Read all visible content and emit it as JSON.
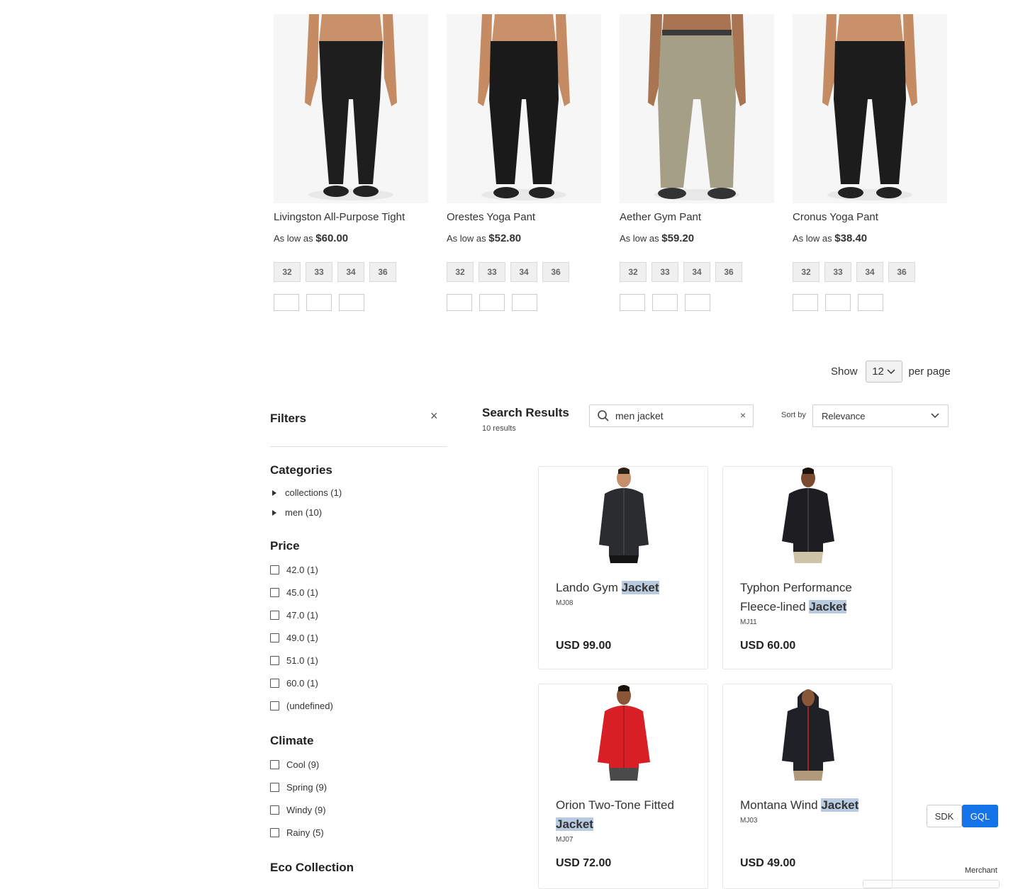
{
  "products": [
    {
      "name": "Livingston All-Purpose Tight",
      "price_prefix": "As low as",
      "price": "$60.00",
      "sizes": [
        "32",
        "33",
        "34",
        "36"
      ],
      "pant_color": "#1e1e1e"
    },
    {
      "name": "Orestes Yoga Pant",
      "price_prefix": "As low as",
      "price": "$52.80",
      "sizes": [
        "32",
        "33",
        "34",
        "36"
      ],
      "pant_color": "#1a1a1a"
    },
    {
      "name": "Aether Gym Pant",
      "price_prefix": "As low as",
      "price": "$59.20",
      "sizes": [
        "32",
        "33",
        "34",
        "36"
      ],
      "pant_color": "#a49f86"
    },
    {
      "name": "Cronus Yoga Pant",
      "price_prefix": "As low as",
      "price": "$38.40",
      "sizes": [
        "32",
        "33",
        "34",
        "36"
      ],
      "pant_color": "#1c1c1c"
    }
  ],
  "toolbar": {
    "show_label": "Show",
    "limit_value": "12",
    "per_page_label": "per page"
  },
  "filters": {
    "title": "Filters",
    "close_icon": "×",
    "categories": {
      "title": "Categories",
      "items": [
        "collections (1)",
        "men (10)"
      ]
    },
    "price": {
      "title": "Price",
      "items": [
        "42.0 (1)",
        "45.0 (1)",
        "47.0 (1)",
        "49.0 (1)",
        "51.0 (1)",
        "60.0 (1)",
        "(undefined)"
      ]
    },
    "climate": {
      "title": "Climate",
      "items": [
        "Cool (9)",
        "Spring (9)",
        "Windy (9)",
        "Rainy (5)"
      ]
    },
    "eco": {
      "title": "Eco Collection"
    }
  },
  "search": {
    "title": "Search Results",
    "count": "10 results",
    "query": "men jacket",
    "clear_icon": "×",
    "sort_label": "Sort by",
    "sort_value": "Relevance"
  },
  "results": [
    {
      "name_pre": "Lando Gym ",
      "name_hl": "Jacket",
      "sku": "MJ08",
      "price": "USD 99.00",
      "jacket_color": "#2a2c2f"
    },
    {
      "name_pre": "Typhon Performance Fleece-lined ",
      "name_hl": "Jacket",
      "sku": "MJ11",
      "price": "USD 60.00",
      "jacket_color": "#1e1e22"
    },
    {
      "name_pre": "Orion Two-Tone Fitted ",
      "name_hl": "Jacket",
      "sku": "MJ07",
      "price": "USD 72.00",
      "jacket_color": "#d81f26"
    },
    {
      "name_pre": "Montana Wind ",
      "name_hl": "Jacket",
      "sku": "MJ03",
      "price": "USD 49.00",
      "jacket_color": "#202126"
    }
  ],
  "widgets": {
    "sdk_label": "SDK",
    "gql_label": "GQL",
    "merchant_label": "Merchant"
  },
  "colors": {
    "accent": "#1473e6",
    "highlight": "#b9cbe0"
  }
}
